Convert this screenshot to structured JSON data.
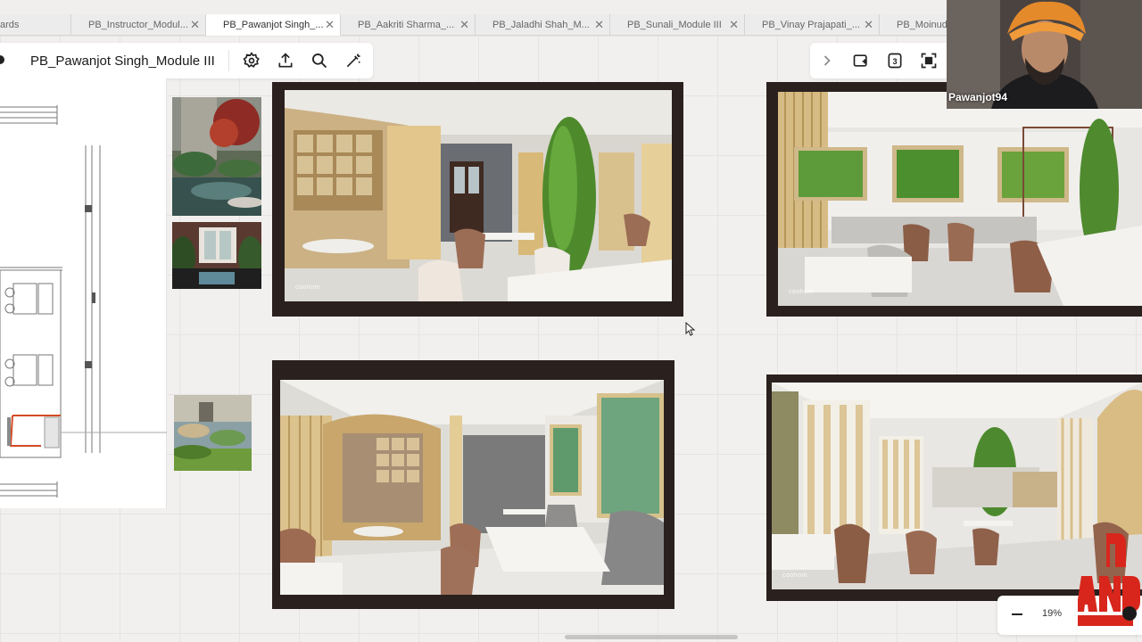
{
  "tabs": [
    {
      "label": "ards",
      "active": false,
      "closable": false
    },
    {
      "label": "PB_Instructor_Modul...",
      "active": false,
      "closable": true
    },
    {
      "label": "PB_Pawanjot Singh_...",
      "active": true,
      "closable": true
    },
    {
      "label": "PB_Aakriti Sharma_...",
      "active": false,
      "closable": true
    },
    {
      "label": "PB_Jaladhi Shah_M...",
      "active": false,
      "closable": true
    },
    {
      "label": "PB_Sunali_Module III",
      "active": false,
      "closable": true
    },
    {
      "label": "PB_Vinay Prajapati_...",
      "active": false,
      "closable": true
    },
    {
      "label": "PB_Moinudd",
      "active": false,
      "closable": false
    }
  ],
  "toolbar": {
    "board_title": "PB_Pawanjot Singh_Module III",
    "icons": [
      "settings-icon",
      "share-upload-icon",
      "search-icon",
      "magic-wand-icon"
    ]
  },
  "right_toolbar": {
    "icons": [
      "chevron-right-icon",
      "add-frame-icon",
      "comment-count-icon",
      "focus-frame-icon"
    ],
    "count_badge": "3"
  },
  "renders": [
    {
      "watermark": "coohom"
    },
    {
      "watermark": "coohom"
    },
    {
      "watermark": ""
    },
    {
      "watermark": "coohom"
    }
  ],
  "webcam": {
    "participant_name": "Pawanjot94"
  },
  "zoom": {
    "value": "19%"
  },
  "colors": {
    "frame": "#2a211f",
    "canvas": "#f2f0ef",
    "tab_active": "#ffffff",
    "logo_red": "#d8261c"
  }
}
